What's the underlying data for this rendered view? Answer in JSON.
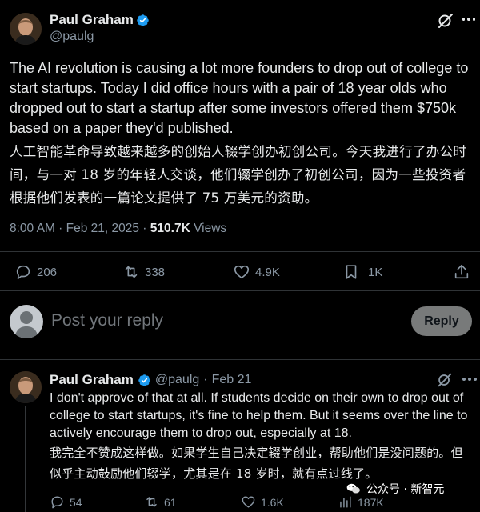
{
  "tweet": {
    "author_name": "Paul Graham",
    "author_handle": "@paulg",
    "text_en": "The AI revolution is causing a lot more founders to drop out of college to start startups. Today I did office hours with a pair of 18 year olds who dropped out to start a startup after some investors offered them $750k based on a paper they'd published.",
    "text_zh": "人工智能革命导致越来越多的创始人辍学创办初创公司。今天我进行了办公时间，与一对 18 岁的年轻人交谈，他们辍学创办了初创公司，因为一些投资者根据他们发表的一篇论文提供了 75 万美元的资助。",
    "time": "8:00 AM · Feb 21, 2025 · ",
    "views_count": "510.7K",
    "views_label": " Views",
    "replies": "206",
    "reposts": "338",
    "likes": "4.9K",
    "bookmarks": "1K"
  },
  "composer": {
    "placeholder": "Post your reply",
    "reply_button": "Reply"
  },
  "reply": {
    "author_name": "Paul Graham",
    "author_handle": "@paulg",
    "separator": "·",
    "date": "Feb 21",
    "text_en": "I don't approve of that at all. If students decide on their own to drop out of college to start startups, it's fine to help them. But it seems over the line to actively encourage them to drop out, especially at 18.",
    "text_zh": "我完全不赞成这样做。如果学生自己决定辍学创业，帮助他们是没问题的。但似乎主动鼓励他们辍学，尤其是在 18 岁时，就有点过线了。",
    "replies": "54",
    "reposts": "61",
    "likes": "1.6K",
    "views": "187K"
  },
  "watermark": {
    "text": "公众号 · 新智元"
  },
  "colors": {
    "background": "#000000",
    "text": "#e7e9ea",
    "secondary": "#8b98a5",
    "verified": "#1d9bf0",
    "divider": "#2f3336",
    "reply_button": "#787a7a"
  },
  "icons": [
    "verified-badge-icon",
    "grok-icon",
    "reply-icon",
    "repost-icon",
    "like-icon",
    "bookmark-icon",
    "share-icon",
    "views-icon",
    "wechat-icon"
  ]
}
